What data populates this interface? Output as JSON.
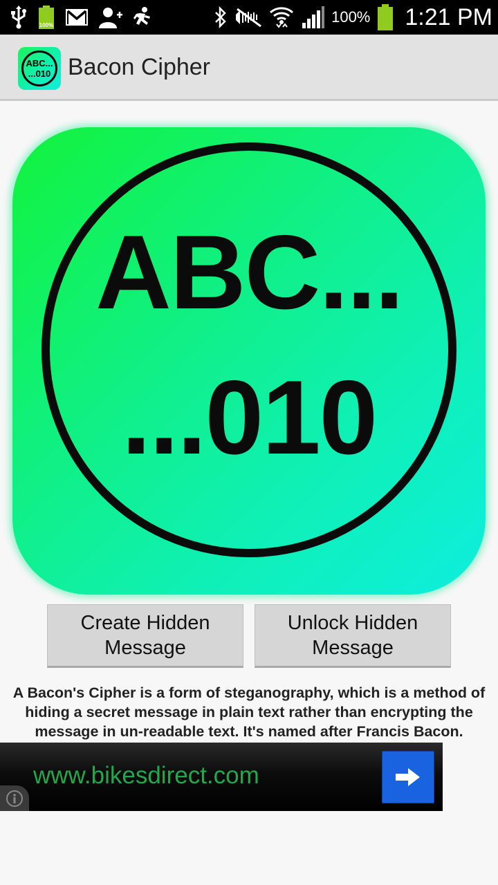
{
  "status_bar": {
    "battery_small_label": "100%",
    "battery_pct": "100%",
    "time": "1:21 PM",
    "icons": [
      "usb-icon",
      "battery-full-icon",
      "gmail-icon",
      "add-contact-icon",
      "running-app-icon",
      "bluetooth-icon",
      "muted-icon",
      "wifi-icon",
      "signal-icon",
      "battery-icon"
    ]
  },
  "action_bar": {
    "app_icon_line1": "ABC...",
    "app_icon_line2": "...010",
    "title": "Bacon Cipher"
  },
  "hero": {
    "line1": "ABC...",
    "line2": "...010",
    "colors": {
      "gradient_start": "#12f33c",
      "gradient_end": "#0eeede"
    }
  },
  "buttons": {
    "create_label": "Create Hidden Message",
    "unlock_label": "Unlock Hidden Message"
  },
  "description": "A Bacon's Cipher is a form of steganography, which is a method of hiding a secret message in plain text rather than encrypting the message in un-readable text.  It's named after Francis Bacon.",
  "ad": {
    "url": "www.bikesdirect.com",
    "url_color": "#20a84a",
    "button_color": "#1a63e0"
  }
}
